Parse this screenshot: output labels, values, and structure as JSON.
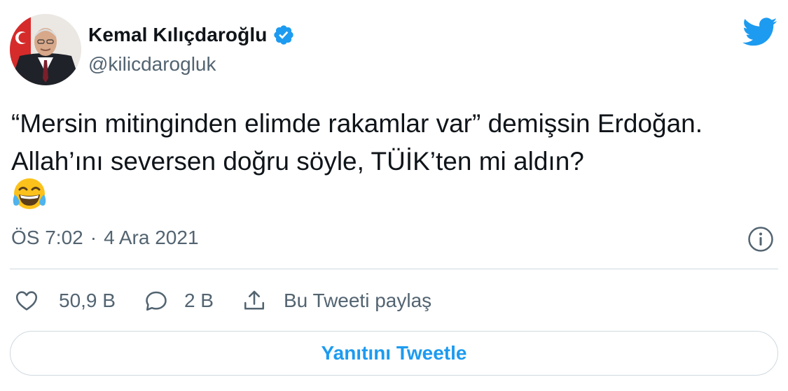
{
  "author": {
    "display_name": "Kemal Kılıçdaroğlu",
    "handle": "@kilicdarogluk",
    "verified": true,
    "avatar_icon": "profile-photo"
  },
  "tweet": {
    "text": "“Mersin mitinginden elimde rakamlar var” demişsin Erdoğan. Allah’ını seversen doğru söyle, TÜİK’ten mi aldın?",
    "emoji": "face-with-tears-of-joy",
    "time": "ÖS 7:02",
    "separator": "·",
    "date": "4 Ara 2021"
  },
  "actions": {
    "likes": "50,9 B",
    "replies": "2 B",
    "share_label": "Bu Tweeti paylaş"
  },
  "reply_button": "Yanıtını Tweetle",
  "colors": {
    "accent": "#1d9bf0",
    "text": "#0f1419",
    "secondary": "#536471",
    "border": "#cfd9de"
  }
}
